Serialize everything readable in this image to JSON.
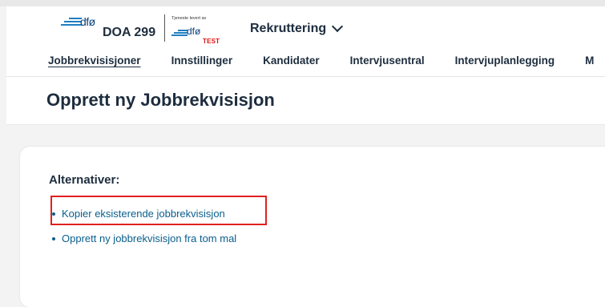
{
  "header": {
    "logo_text": "dfø",
    "tenant_code": "DOA 299",
    "provided_by": "Tjeneste levert av",
    "provider_logo_text": "dfø",
    "environment": "TEST",
    "app_menu_label": "Rekruttering",
    "app_menu_icon": "chevron-down-icon"
  },
  "nav": {
    "tabs": [
      {
        "label": "Jobbrekvisisjoner",
        "active": true
      },
      {
        "label": "Innstillinger"
      },
      {
        "label": "Kandidater"
      },
      {
        "label": "Intervjusentral"
      },
      {
        "label": "Intervjuplanlegging"
      },
      {
        "label": "M"
      }
    ]
  },
  "page": {
    "title": "Opprett ny Jobbrekvisisjon"
  },
  "alternatives": {
    "heading": "Alternativer:",
    "items": [
      {
        "label": "Kopier eksisterende jobbrekvisisjon",
        "highlighted": true
      },
      {
        "label": "Opprett ny jobbrekvisisjon fra tom mal"
      }
    ]
  },
  "colors": {
    "brand_blue": "#0a3f7a",
    "link": "#0a5e8c",
    "highlight": "#e02020",
    "test_label": "#dd1111"
  }
}
